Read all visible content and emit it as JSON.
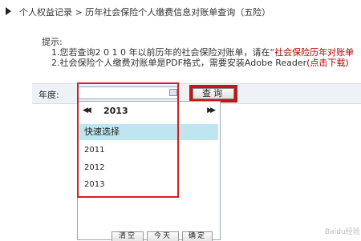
{
  "breadcrumb": {
    "text": "个人权益记录 > 历年社会保险个人缴费信息对账单查询（五险）"
  },
  "tips": {
    "title": "提示:",
    "line1_pre": "1.您若查询2 0 1 0 年以前历年的社会保险对账单，请在",
    "line1_link": "“社会保险历年对账单",
    "line2_pre": "2.社会保险个人缴费对账单是PDF格式，需要安装Adobe Reader",
    "line2_link": "(点击下载)"
  },
  "query": {
    "year_label": "年度:",
    "year_value": "",
    "button_label": "查询"
  },
  "picker": {
    "prev_glyph": "◀◀",
    "next_glyph": "▶▶",
    "year": "2013",
    "quick_select_label": "快速选择",
    "options": [
      "2011",
      "2012",
      "2013"
    ],
    "footer_buttons": [
      "清空",
      "今天",
      "确定"
    ]
  },
  "watermark": "Baidu经验",
  "colors": {
    "highlight": "#d42020",
    "quick_select_bg": "#bfe6f0",
    "link": "#b40000"
  }
}
